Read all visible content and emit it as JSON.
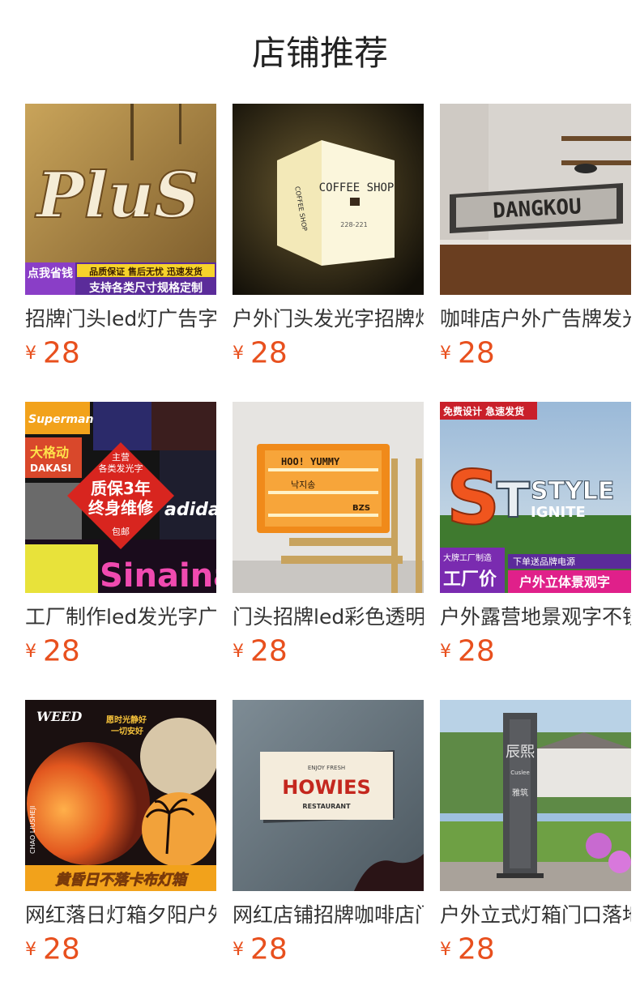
{
  "page": {
    "title": "店铺推荐"
  },
  "colors": {
    "price": "#e8501e",
    "title_text": "#333333"
  },
  "products": [
    {
      "title": "招牌门头led灯广告字",
      "currency": "¥",
      "price": "28",
      "image": {
        "name": "plus-sign-image",
        "text_main": "PluS",
        "badge_left": "点我省钱",
        "banner_top": "品质保证 售后无忧 迅速发货",
        "banner_bottom": "支持各类尺寸规格定制"
      }
    },
    {
      "title": "户外门头发光字招牌灯",
      "currency": "¥",
      "price": "28",
      "image": {
        "name": "coffee-shop-lightbox-image",
        "text_main": "COFFEE SHOP",
        "text_side": "COFFEE SHOP",
        "text_small": "228-221"
      }
    },
    {
      "title": "咖啡店户外广告牌发光",
      "currency": "¥",
      "price": "28",
      "image": {
        "name": "dangkou-sign-image",
        "text_main": "DANGKOU"
      }
    },
    {
      "title": "工厂制作led发光字广告",
      "currency": "¥",
      "price": "28",
      "image": {
        "name": "led-letters-collage-image",
        "badge_line1": "主营",
        "badge_line2": "各类发光字",
        "badge_line3": "质保3年",
        "badge_line4": "终身维修",
        "badge_line5": "包邮",
        "brand1": "Superman toy",
        "brand2": "大格动",
        "brand3": "DAKASI",
        "brand4": "Sinaina",
        "brand5": "adidas"
      }
    },
    {
      "title": "门头招牌led彩色透明",
      "currency": "¥",
      "price": "28",
      "image": {
        "name": "orange-acrylic-sign-image",
        "text_main": "HOO! YUMMY",
        "text_sub": "낙지송",
        "text_tag": "BZS"
      }
    },
    {
      "title": "户外露营地景观字不锈",
      "currency": "¥",
      "price": "28",
      "image": {
        "name": "style-landscape-letters-image",
        "text_main": "STYLE",
        "text_sub": "IGNITE",
        "badge_top": "免费设计 急速发货",
        "badge_factory": "大牌工厂制造",
        "badge_price": "工厂价",
        "badge_free": "下单送品牌电源",
        "badge_product": "户外立体景观字"
      }
    },
    {
      "title": "网红落日灯箱夕阳户外",
      "currency": "¥",
      "price": "28",
      "image": {
        "name": "sunset-lightbox-image",
        "text_brand": "WEED",
        "text_slogan1": "愿时光静好",
        "text_slogan2": "一切安好",
        "text_side": "CHAO LIUSHEJI",
        "banner": "黄昏日不落卡布灯箱"
      }
    },
    {
      "title": "网红店铺招牌咖啡店门",
      "currency": "¥",
      "price": "28",
      "image": {
        "name": "howies-lightbox-image",
        "text_small": "ENJOY FRESH",
        "text_main": "HOWIES",
        "text_sub": "RESTAURANT"
      }
    },
    {
      "title": "户外立式灯箱门口落地",
      "currency": "¥",
      "price": "28",
      "image": {
        "name": "standing-sign-pylon-image",
        "text_main": "辰熙",
        "text_en": "Cuslee",
        "text_sub": "雅筑"
      }
    }
  ]
}
